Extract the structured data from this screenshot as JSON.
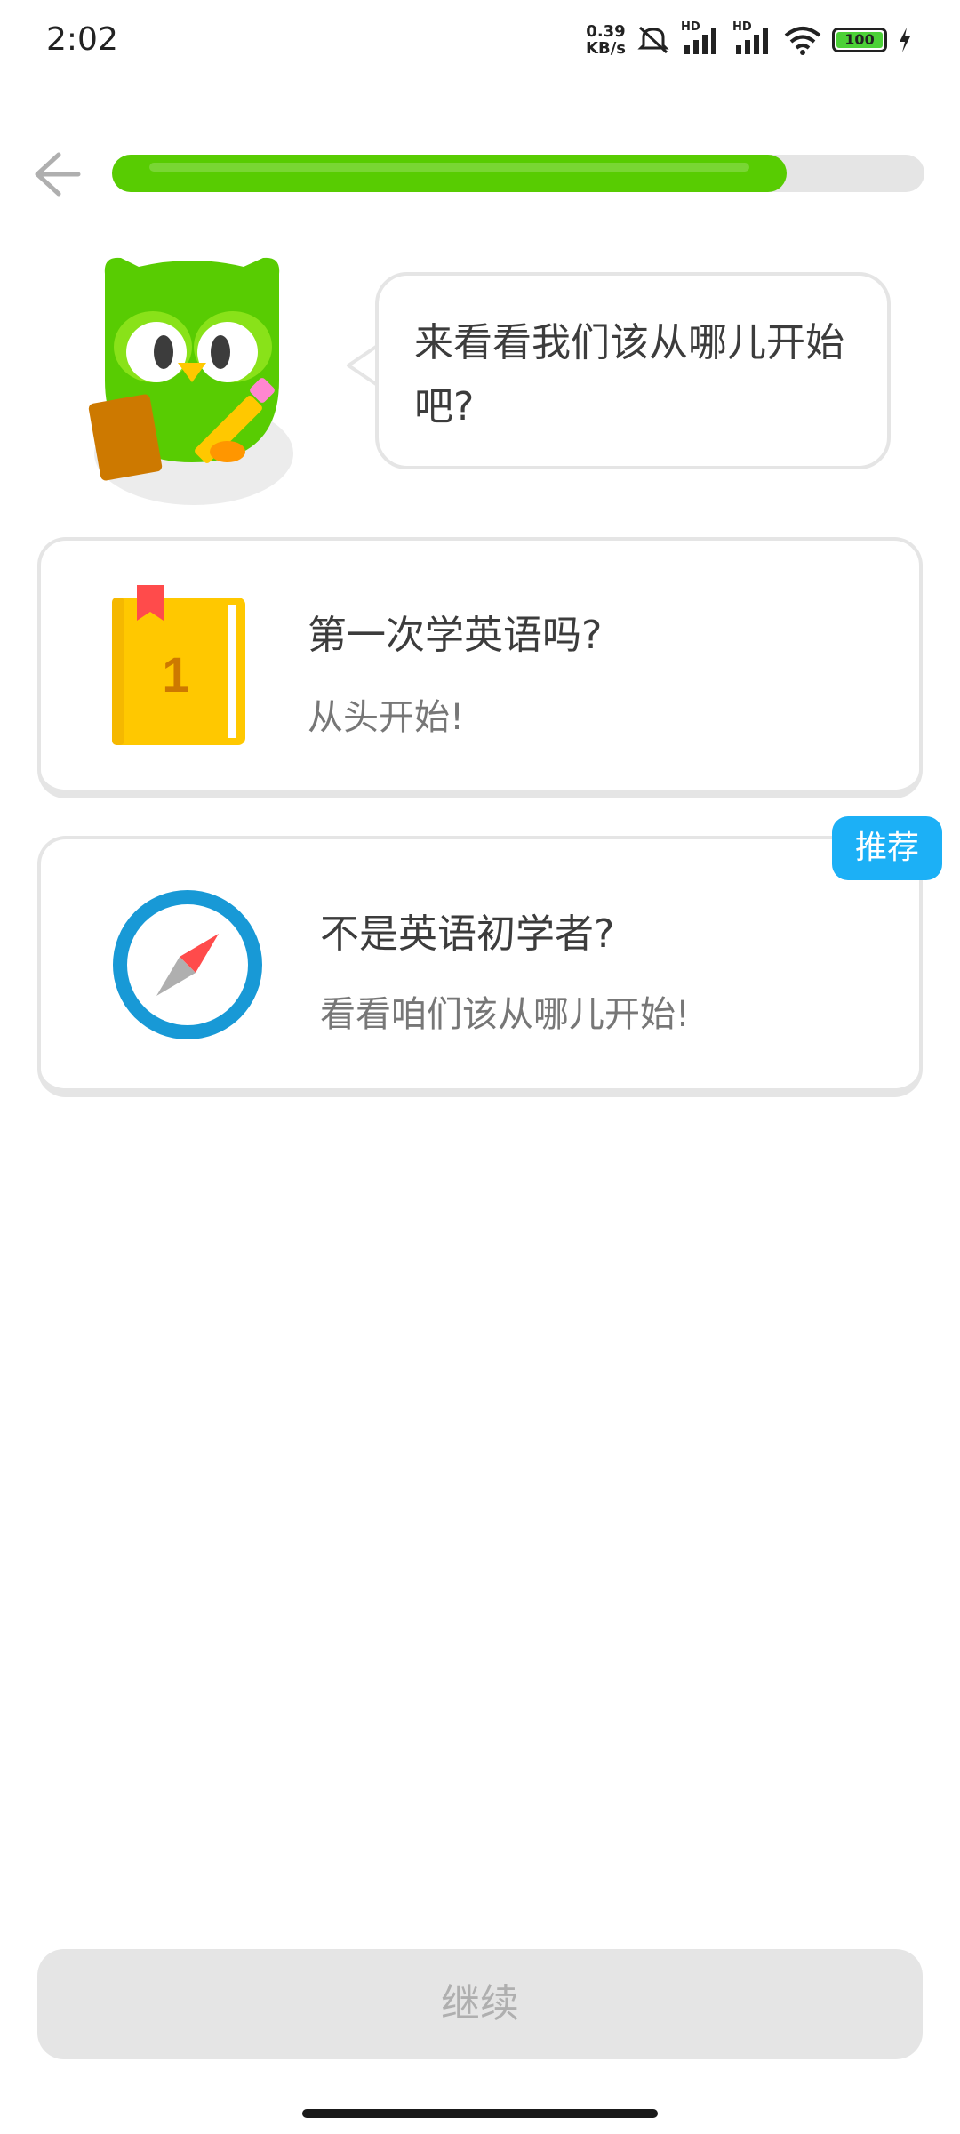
{
  "status_bar": {
    "time": "2:02",
    "net_speed_value": "0.39",
    "net_speed_unit": "KB/s",
    "signal_label_1": "HD",
    "signal_label_2": "HD",
    "battery": "100",
    "icons": [
      "mute-icon",
      "signal-icon",
      "signal-icon",
      "wifi-icon",
      "battery-icon",
      "charging-icon"
    ]
  },
  "header": {
    "back_icon": "arrow-left-icon",
    "progress_fraction": 0.83
  },
  "mascot": {
    "speech": "来看看我们该从哪儿开始吧?"
  },
  "options": [
    {
      "title": "第一次学英语吗?",
      "subtitle": "从头开始!",
      "icon": "book-icon",
      "icon_number": "1"
    },
    {
      "title": "不是英语初学者?",
      "subtitle": "看看咱们该从哪儿开始!",
      "icon": "compass-icon",
      "badge": "推荐"
    }
  ],
  "footer": {
    "continue_label": "继续"
  },
  "colors": {
    "primary_green": "#58cc02",
    "badge_blue": "#1cb0f6",
    "disabled_gray": "#e5e5e5"
  }
}
